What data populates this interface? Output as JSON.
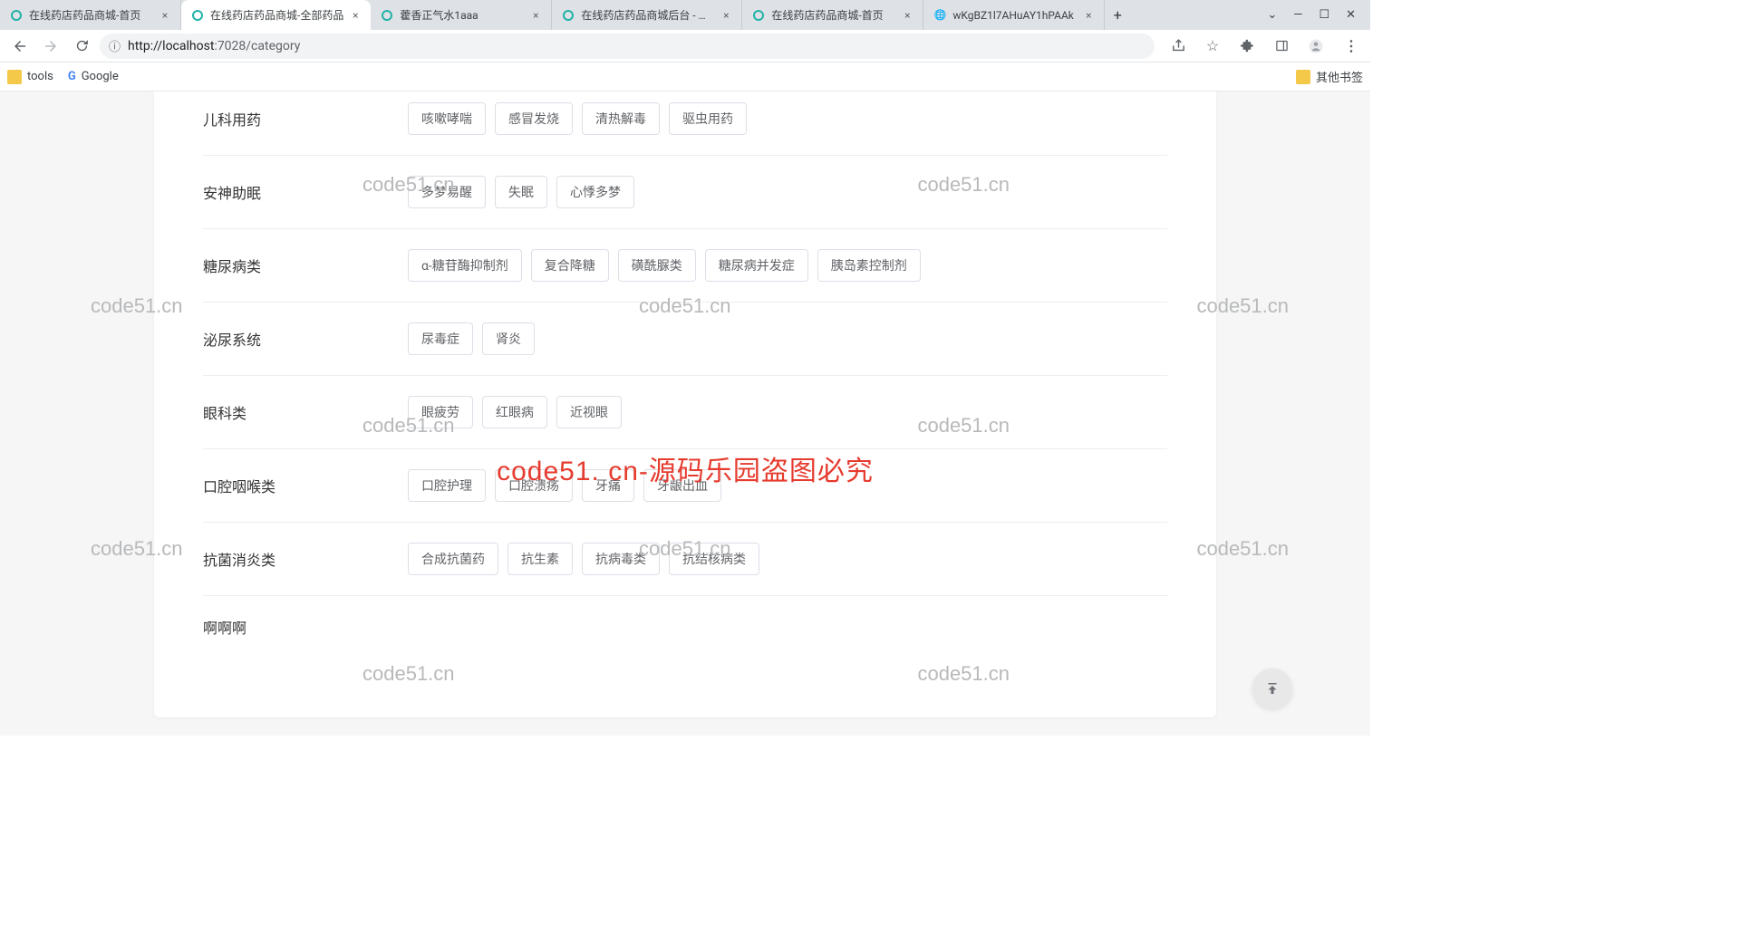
{
  "browser": {
    "tabs": [
      {
        "title": "在线药店药品商城-首页",
        "favicon": "teal"
      },
      {
        "title": "在线药店药品商城-全部药品",
        "favicon": "teal",
        "active": true
      },
      {
        "title": "藿香正气水1aaa",
        "favicon": "teal"
      },
      {
        "title": "在线药店药品商城后台 - 药品",
        "favicon": "teal"
      },
      {
        "title": "在线药店药品商城-首页",
        "favicon": "teal"
      },
      {
        "title": "wKgBZ1l7AHuAY1hPAAk",
        "favicon": "globe"
      }
    ],
    "url_prefix": "localhost",
    "url_suffix": ":7028/category",
    "url_protocol_icon": "ⓘ",
    "bookmarks": {
      "tools": "tools",
      "google": "Google",
      "other": "其他书签"
    }
  },
  "categories": [
    {
      "label": "儿科用药",
      "chips": [
        "咳嗽哮喘",
        "感冒发烧",
        "清热解毒",
        "驱虫用药"
      ]
    },
    {
      "label": "安神助眠",
      "chips": [
        "多梦易醒",
        "失眠",
        "心悸多梦"
      ]
    },
    {
      "label": "糖尿病类",
      "chips": [
        "α-糖苷酶抑制剂",
        "复合降糖",
        "磺酰脲类",
        "糖尿病并发症",
        "胰岛素控制剂"
      ]
    },
    {
      "label": "泌尿系统",
      "chips": [
        "尿毒症",
        "肾炎"
      ]
    },
    {
      "label": "眼科类",
      "chips": [
        "眼疲劳",
        "红眼病",
        "近视眼"
      ]
    },
    {
      "label": "口腔咽喉类",
      "chips": [
        "口腔护理",
        "口腔溃疡",
        "牙痛",
        "牙龈出血"
      ]
    },
    {
      "label": "抗菌消炎类",
      "chips": [
        "合成抗菌药",
        "抗生素",
        "抗病毒类",
        "抗结核病类"
      ]
    },
    {
      "label": "啊啊啊",
      "chips": []
    }
  ],
  "watermark": {
    "text": "code51.cn",
    "center": "code51. cn-源码乐园盗图必究"
  }
}
